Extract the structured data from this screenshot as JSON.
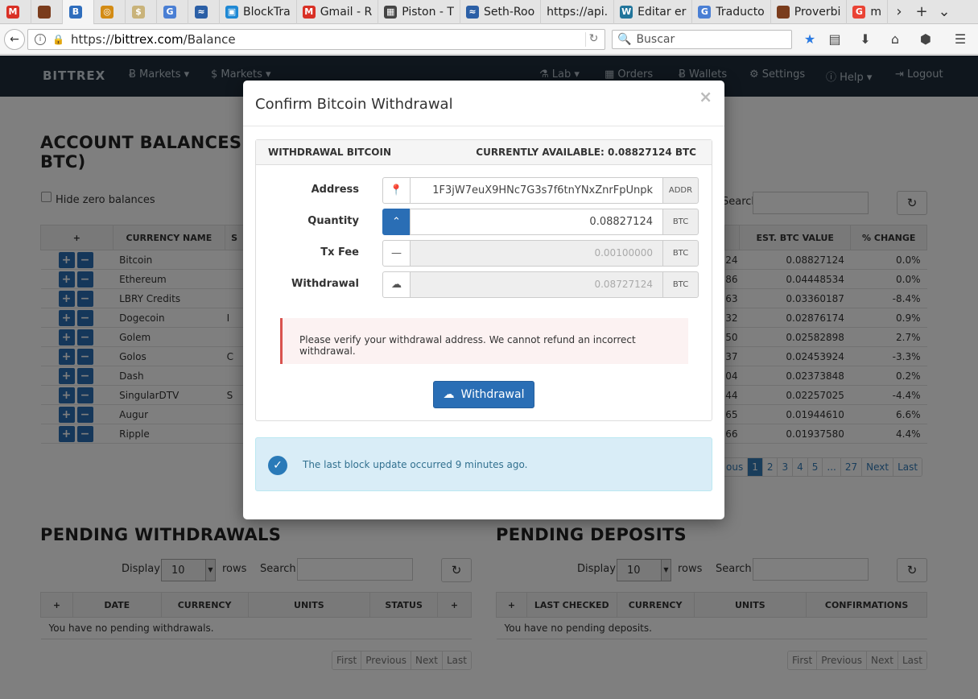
{
  "browser": {
    "tabs": [
      {
        "label": "",
        "fav": "M",
        "color": "#d93025"
      },
      {
        "label": "",
        "fav": "",
        "color": "#7a3c1c"
      },
      {
        "label": "",
        "fav": "B",
        "color": "#2f6ebd"
      },
      {
        "label": "",
        "fav": "◎",
        "color": "#d38b14"
      },
      {
        "label": "",
        "fav": "$",
        "color": "#c9b37a"
      },
      {
        "label": "",
        "fav": "G",
        "color": "#4a7fd4"
      },
      {
        "label": "",
        "fav": "≈",
        "color": "#2b5fa6"
      },
      {
        "label": "BlockTra",
        "fav": "▣",
        "color": "#1e88d4"
      },
      {
        "label": "Gmail - R",
        "fav": "M",
        "color": "#d93025"
      },
      {
        "label": "Piston - T",
        "fav": "▦",
        "color": "#444"
      },
      {
        "label": "Seth-Roo",
        "fav": "≈",
        "color": "#2b5fa6"
      },
      {
        "label": "https://api.",
        "fav": "",
        "color": "transparent"
      },
      {
        "label": "Editar er",
        "fav": "W",
        "color": "#21759b"
      },
      {
        "label": "Traducto",
        "fav": "G",
        "color": "#4a7fd4"
      },
      {
        "label": "Proverbi",
        "fav": "",
        "color": "#7a3c1c"
      },
      {
        "label": "m",
        "fav": "G",
        "color": "#ea4335"
      }
    ],
    "url_prefix": "https://",
    "url_domain": "bittrex.com",
    "url_path": "/Balance",
    "search_placeholder": "Buscar"
  },
  "site_nav": {
    "brand": "BITTREX",
    "markets_btc": "Ƀ Markets ▾",
    "markets_usd": "$ Markets ▾",
    "lab": "⚗ Lab ▾",
    "orders": "▦  Orders",
    "wallets": "Ƀ  Wallets",
    "settings": "⚙  Settings",
    "help": "ⓘ Help ▾",
    "logout": "⇥  Logout"
  },
  "balances": {
    "title_line1": "ACCOUNT BALANCES (E",
    "title_line2": "BTC)",
    "hide_zero": "Hide zero balances",
    "search_label": "Search:",
    "headers": {
      "add": "+",
      "currency_name": "CURRENCY NAME",
      "sym": "S",
      "est_btc": "EST. BTC VALUE",
      "change": "% CHANGE"
    },
    "rows": [
      {
        "name": "Bitcoin",
        "sym": "",
        "partial": "24",
        "btc": "0.08827124",
        "chg": "0.0%"
      },
      {
        "name": "Ethereum",
        "sym": "",
        "partial": "86",
        "btc": "0.04448534",
        "chg": "0.0%"
      },
      {
        "name": "LBRY Credits",
        "sym": "",
        "partial": "63",
        "btc": "0.03360187",
        "chg": "-8.4%"
      },
      {
        "name": "Dogecoin",
        "sym": "I",
        "partial": "32",
        "btc": "0.02876174",
        "chg": "0.9%"
      },
      {
        "name": "Golem",
        "sym": "",
        "partial": "50",
        "btc": "0.02582898",
        "chg": "2.7%"
      },
      {
        "name": "Golos",
        "sym": "C",
        "partial": "37",
        "btc": "0.02453924",
        "chg": "-3.3%"
      },
      {
        "name": "Dash",
        "sym": "",
        "partial": "04",
        "btc": "0.02373848",
        "chg": "0.2%"
      },
      {
        "name": "SingularDTV",
        "sym": "S",
        "partial": "44",
        "btc": "0.02257025",
        "chg": "-4.4%"
      },
      {
        "name": "Augur",
        "sym": "",
        "partial": "65",
        "btc": "0.01944610",
        "chg": "6.6%"
      },
      {
        "name": "Ripple",
        "sym": "",
        "partial": "66",
        "btc": "0.01937580",
        "chg": "4.4%"
      }
    ],
    "pagination": [
      "ous",
      "1",
      "2",
      "3",
      "4",
      "5",
      "...",
      "27",
      "Next",
      "Last"
    ]
  },
  "pending_withdrawals": {
    "title": "PENDING WITHDRAWALS",
    "display_label": "Display",
    "rows_value": "10",
    "rows_label": "rows",
    "search_label": "Search:",
    "headers": [
      "+",
      "DATE",
      "CURRENCY",
      "UNITS",
      "STATUS",
      "+"
    ],
    "empty": "You have no pending withdrawals.",
    "pager": [
      "First",
      "Previous",
      "Next",
      "Last"
    ]
  },
  "pending_deposits": {
    "title": "PENDING DEPOSITS",
    "display_label": "Display",
    "rows_value": "10",
    "rows_label": "rows",
    "search_label": "Search:",
    "headers": [
      "+",
      "LAST CHECKED",
      "CURRENCY",
      "UNITS",
      "CONFIRMATIONS"
    ],
    "empty": "You have no pending deposits.",
    "pager": [
      "First",
      "Previous",
      "Next",
      "Last"
    ]
  },
  "modal": {
    "title": "Confirm Bitcoin Withdrawal",
    "close": "×",
    "panel_left": "WITHDRAWAL BITCOIN",
    "panel_right": "CURRENTLY AVAILABLE: 0.08827124 BTC",
    "address_label": "Address",
    "address_value": "1F3jW7euX9HNc7G3s7f6tnYNxZnrFpUnpk",
    "address_addon": "ADDR",
    "quantity_label": "Quantity",
    "quantity_value": "0.08827124",
    "quantity_addon": "BTC",
    "txfee_label": "Tx Fee",
    "txfee_value": "0.00100000",
    "txfee_addon": "BTC",
    "withdrawal_label": "Withdrawal",
    "withdrawal_value": "0.08727124",
    "withdrawal_addon": "BTC",
    "warning": "Please verify your withdrawal address. We cannot refund an incorrect withdrawal.",
    "button": "Withdrawal",
    "info": "The last block update occurred 9 minutes ago."
  }
}
